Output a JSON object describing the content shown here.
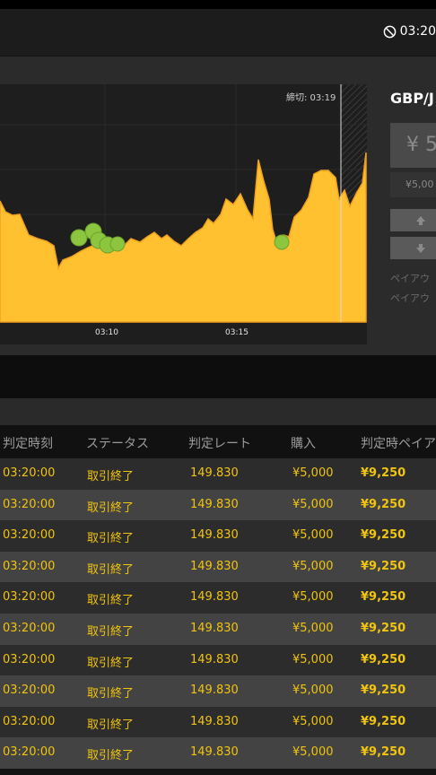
{
  "header": {
    "time": "03:20"
  },
  "chart": {
    "deadline_label": "締切: 03:19",
    "ticks": [
      "03:10",
      "03:15"
    ]
  },
  "trade": {
    "pair": "GBP/J",
    "price": "¥ 5,",
    "amount": "¥5,00",
    "payout1": "ペイアウ",
    "payout2": "ペイアウ"
  },
  "table": {
    "headers": [
      "判定時刻",
      "ステータス",
      "判定レート",
      "購入",
      "判定時ペイアウ"
    ],
    "rows": [
      {
        "time": "03:20:00",
        "status": "取引終了",
        "rate": "149.830",
        "purchase": "¥5,000",
        "payout": "¥9,250"
      },
      {
        "time": "03:20:00",
        "status": "取引終了",
        "rate": "149.830",
        "purchase": "¥5,000",
        "payout": "¥9,250"
      },
      {
        "time": "03:20:00",
        "status": "取引終了",
        "rate": "149.830",
        "purchase": "¥5,000",
        "payout": "¥9,250"
      },
      {
        "time": "03:20:00",
        "status": "取引終了",
        "rate": "149.830",
        "purchase": "¥5,000",
        "payout": "¥9,250"
      },
      {
        "time": "03:20:00",
        "status": "取引終了",
        "rate": "149.830",
        "purchase": "¥5,000",
        "payout": "¥9,250"
      },
      {
        "time": "03:20:00",
        "status": "取引終了",
        "rate": "149.830",
        "purchase": "¥5,000",
        "payout": "¥9,250"
      },
      {
        "time": "03:20:00",
        "status": "取引終了",
        "rate": "149.830",
        "purchase": "¥5,000",
        "payout": "¥9,250"
      },
      {
        "time": "03:20:00",
        "status": "取引終了",
        "rate": "149.830",
        "purchase": "¥5,000",
        "payout": "¥9,250"
      },
      {
        "time": "03:20:00",
        "status": "取引終了",
        "rate": "149.830",
        "purchase": "¥5,000",
        "payout": "¥9,250"
      },
      {
        "time": "03:20:00",
        "status": "取引終了",
        "rate": "149.830",
        "purchase": "¥5,000",
        "payout": "¥9,250"
      }
    ]
  },
  "colors": {
    "accent": "#f1c40f",
    "area": "#ffc12f",
    "marker": "#8cc63f"
  }
}
